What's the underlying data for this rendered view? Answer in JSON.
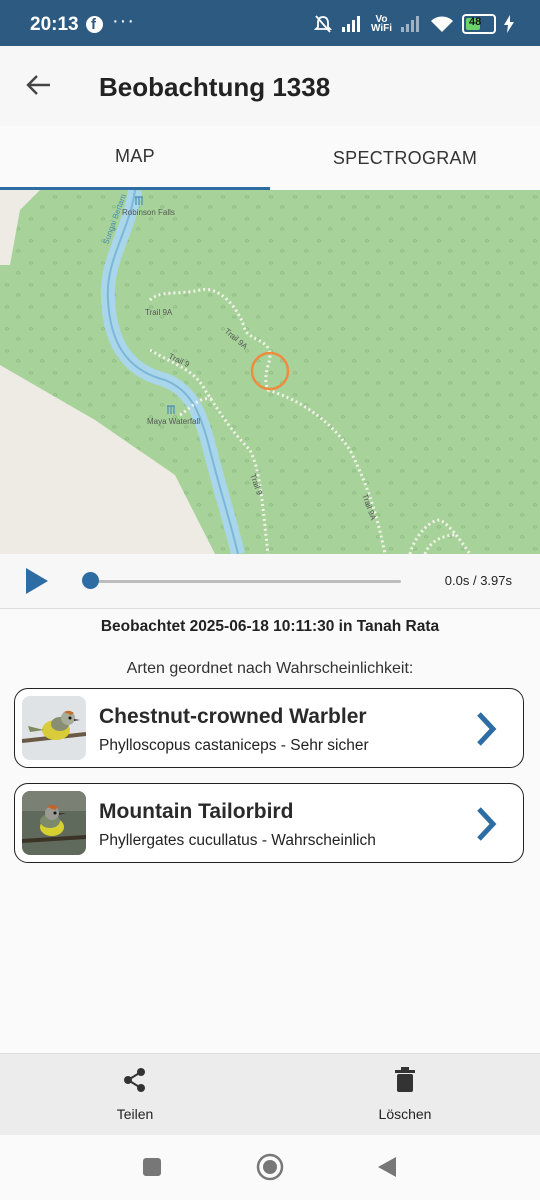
{
  "status_bar": {
    "time": "20:13",
    "battery": "48",
    "vowifi_top": "Vo",
    "vowifi_bottom": "WiFi"
  },
  "app_bar": {
    "title": "Beobachtung 1338"
  },
  "tabs": [
    {
      "label": "MAP",
      "active": true
    },
    {
      "label": "SPECTROGRAM",
      "active": false
    }
  ],
  "map": {
    "labels": [
      "Robinson Falls",
      "Trail 9A",
      "Trail 9A",
      "Trail 9",
      "Maya Waterfall",
      "Trail 9",
      "Trail 9A",
      "Sungai Bertam"
    ]
  },
  "player": {
    "time": "0.0s / 3.97s",
    "progress": 0.0
  },
  "observed_text": "Beobachtet 2025-06-18 10:11:30 in Tanah Rata",
  "species_heading": "Arten geordnet nach Wahrscheinlichkeit:",
  "species": [
    {
      "common_name": "Chestnut-crowned Warbler",
      "detail": "Phylloscopus castaniceps - Sehr sicher"
    },
    {
      "common_name": "Mountain Tailorbird",
      "detail": "Phyllergates cucullatus - Wahrscheinlich"
    }
  ],
  "actions": {
    "share": "Teilen",
    "delete": "Löschen"
  },
  "colors": {
    "accent": "#2e6da4",
    "status_bar": "#2d5a80",
    "map_green": "#a7d39b"
  }
}
